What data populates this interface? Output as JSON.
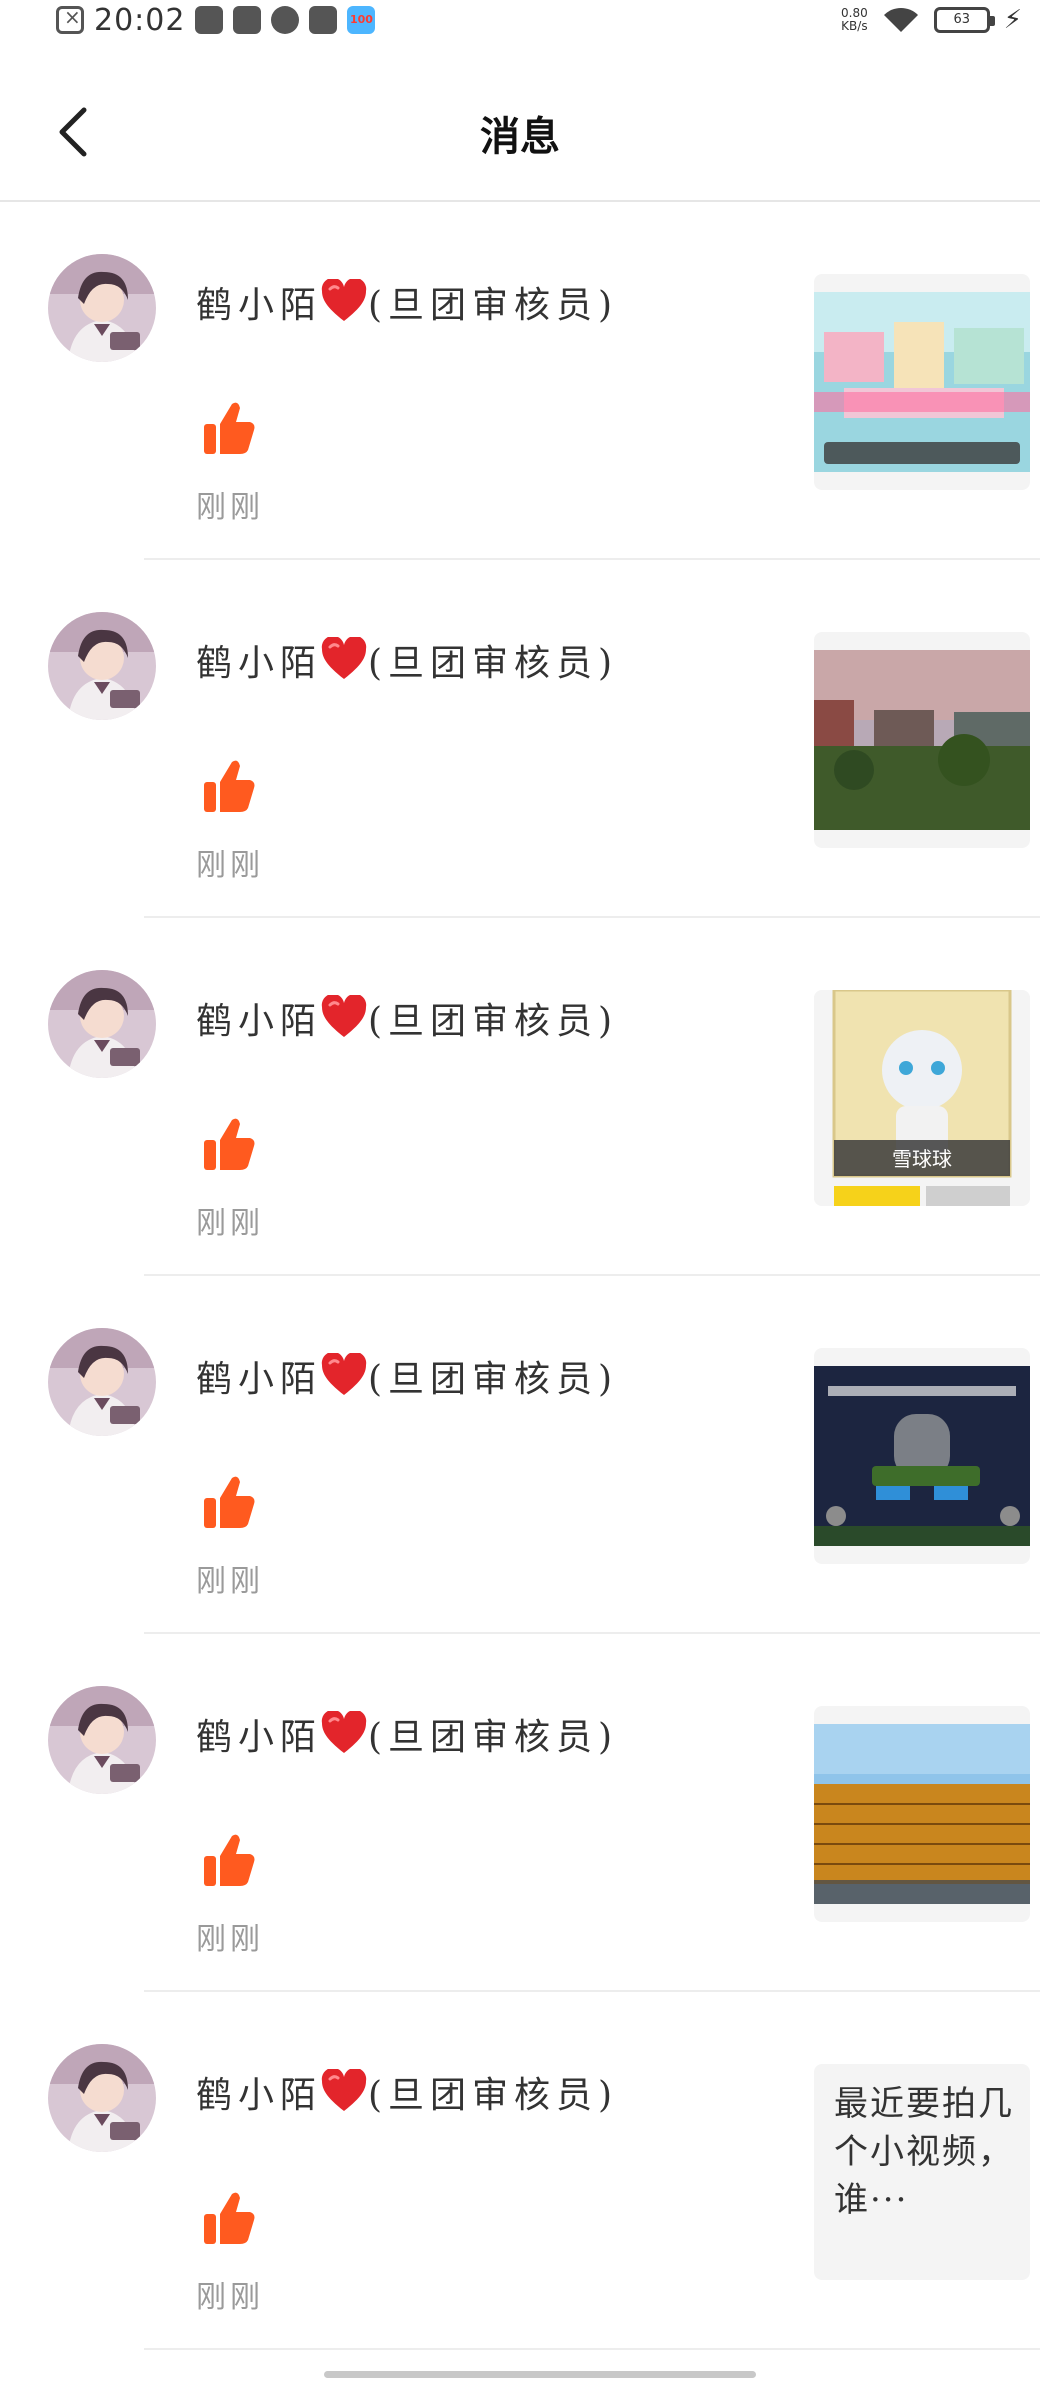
{
  "status_bar": {
    "time": "20:02",
    "net_speed_value": "0.80",
    "net_speed_unit": "KB/s",
    "battery": "63"
  },
  "header": {
    "title": "消息"
  },
  "messages": [
    {
      "user": "鹤小陌",
      "role": "(旦团审核员)",
      "time": "刚刚",
      "preview_type": "image",
      "preview_scene": "pastel-blocks"
    },
    {
      "user": "鹤小陌",
      "role": "(旦团审核员)",
      "time": "刚刚",
      "preview_type": "image",
      "preview_scene": "sunset-field"
    },
    {
      "user": "鹤小陌",
      "role": "(旦团审核员)",
      "time": "刚刚",
      "preview_type": "image",
      "preview_scene": "character-card",
      "preview_caption": "雪球球"
    },
    {
      "user": "鹤小陌",
      "role": "(旦团审核员)",
      "time": "刚刚",
      "preview_type": "image",
      "preview_scene": "game-over"
    },
    {
      "user": "鹤小陌",
      "role": "(旦团审核员)",
      "time": "刚刚",
      "preview_type": "image",
      "preview_scene": "block-wall"
    },
    {
      "user": "鹤小陌",
      "role": "(旦团审核员)",
      "time": "刚刚",
      "preview_type": "text",
      "preview_text": "最近要拍几个小视频，谁···"
    }
  ],
  "colors": {
    "like": "#ff5a1f",
    "heart": "#e3252b",
    "divider": "#ededed",
    "time_text": "#9a9a9a"
  }
}
